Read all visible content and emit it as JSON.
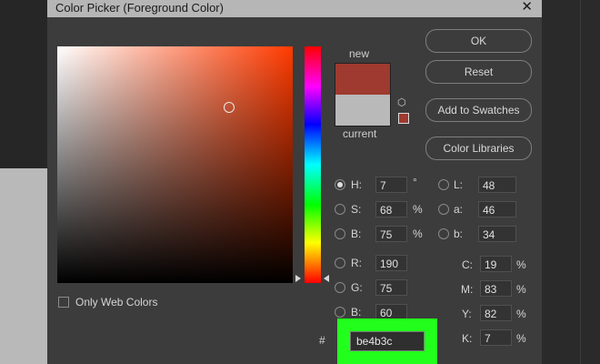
{
  "dialog": {
    "title": "Color Picker (Foreground Color)",
    "close_glyph": "✕"
  },
  "buttons": {
    "ok": "OK",
    "reset": "Reset",
    "add_to_swatches": "Add to Swatches",
    "color_libraries": "Color Libraries"
  },
  "preview": {
    "new_label": "new",
    "current_label": "current",
    "new_color": "#9e3a2f",
    "current_color": "#b9b9b9"
  },
  "options": {
    "only_web_colors_label": "Only Web Colors",
    "only_web_colors_checked": false
  },
  "hsb": {
    "h": {
      "label": "H:",
      "value": "7",
      "unit": "°",
      "selected": true
    },
    "s": {
      "label": "S:",
      "value": "68",
      "unit": "%"
    },
    "b": {
      "label": "B:",
      "value": "75",
      "unit": "%"
    }
  },
  "rgb": {
    "r": {
      "label": "R:",
      "value": "190"
    },
    "g": {
      "label": "G:",
      "value": "75"
    },
    "b": {
      "label": "B:",
      "value": "60"
    }
  },
  "lab": {
    "l": {
      "label": "L:",
      "value": "48"
    },
    "a": {
      "label": "a:",
      "value": "46"
    },
    "b": {
      "label": "b:",
      "value": "34"
    }
  },
  "cmyk": {
    "c": {
      "label": "C:",
      "value": "19",
      "unit": "%"
    },
    "m": {
      "label": "M:",
      "value": "83",
      "unit": "%"
    },
    "y": {
      "label": "Y:",
      "value": "82",
      "unit": "%"
    },
    "k": {
      "label": "K:",
      "value": "7",
      "unit": "%"
    }
  },
  "hex": {
    "hash": "#",
    "value": "be4b3c",
    "highlight_color": "#22ff1c"
  },
  "icons": {
    "cube": "⬡"
  }
}
